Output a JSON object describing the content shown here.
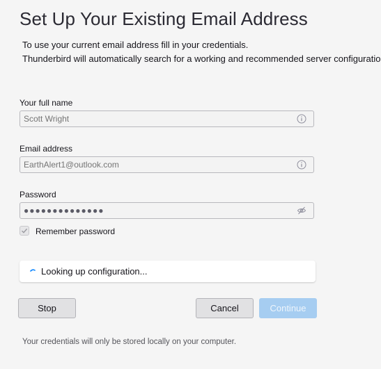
{
  "title": "Set Up Your Existing Email Address",
  "intro": {
    "line1": "To use your current email address fill in your credentials.",
    "line2": "Thunderbird will automatically search for a working and recommended server configuration."
  },
  "form": {
    "full_name": {
      "label": "Your full name",
      "placeholder": "Scott Wright",
      "value": ""
    },
    "email": {
      "label": "Email address",
      "placeholder": "EarthAlert1@outlook.com",
      "value": ""
    },
    "password": {
      "label": "Password",
      "masked_value": "●●●●●●●●●●●●●●"
    },
    "remember_password": {
      "label": "Remember password",
      "checked": true
    }
  },
  "status": {
    "text": "Looking up configuration..."
  },
  "buttons": {
    "stop": "Stop",
    "cancel": "Cancel",
    "continue": "Continue"
  },
  "footer": {
    "note": "Your credentials will only be stored locally on your computer."
  },
  "colors": {
    "background": "#f5f5f5",
    "continue_disabled": "#a6cdf1",
    "spinner": "#0a84ff"
  },
  "icons": {
    "full_name_info": "info-icon",
    "email_info": "info-icon",
    "password_toggle": "eye-slash-icon",
    "checkbox_mark": "checkmark-icon",
    "status": "spinner-icon"
  }
}
